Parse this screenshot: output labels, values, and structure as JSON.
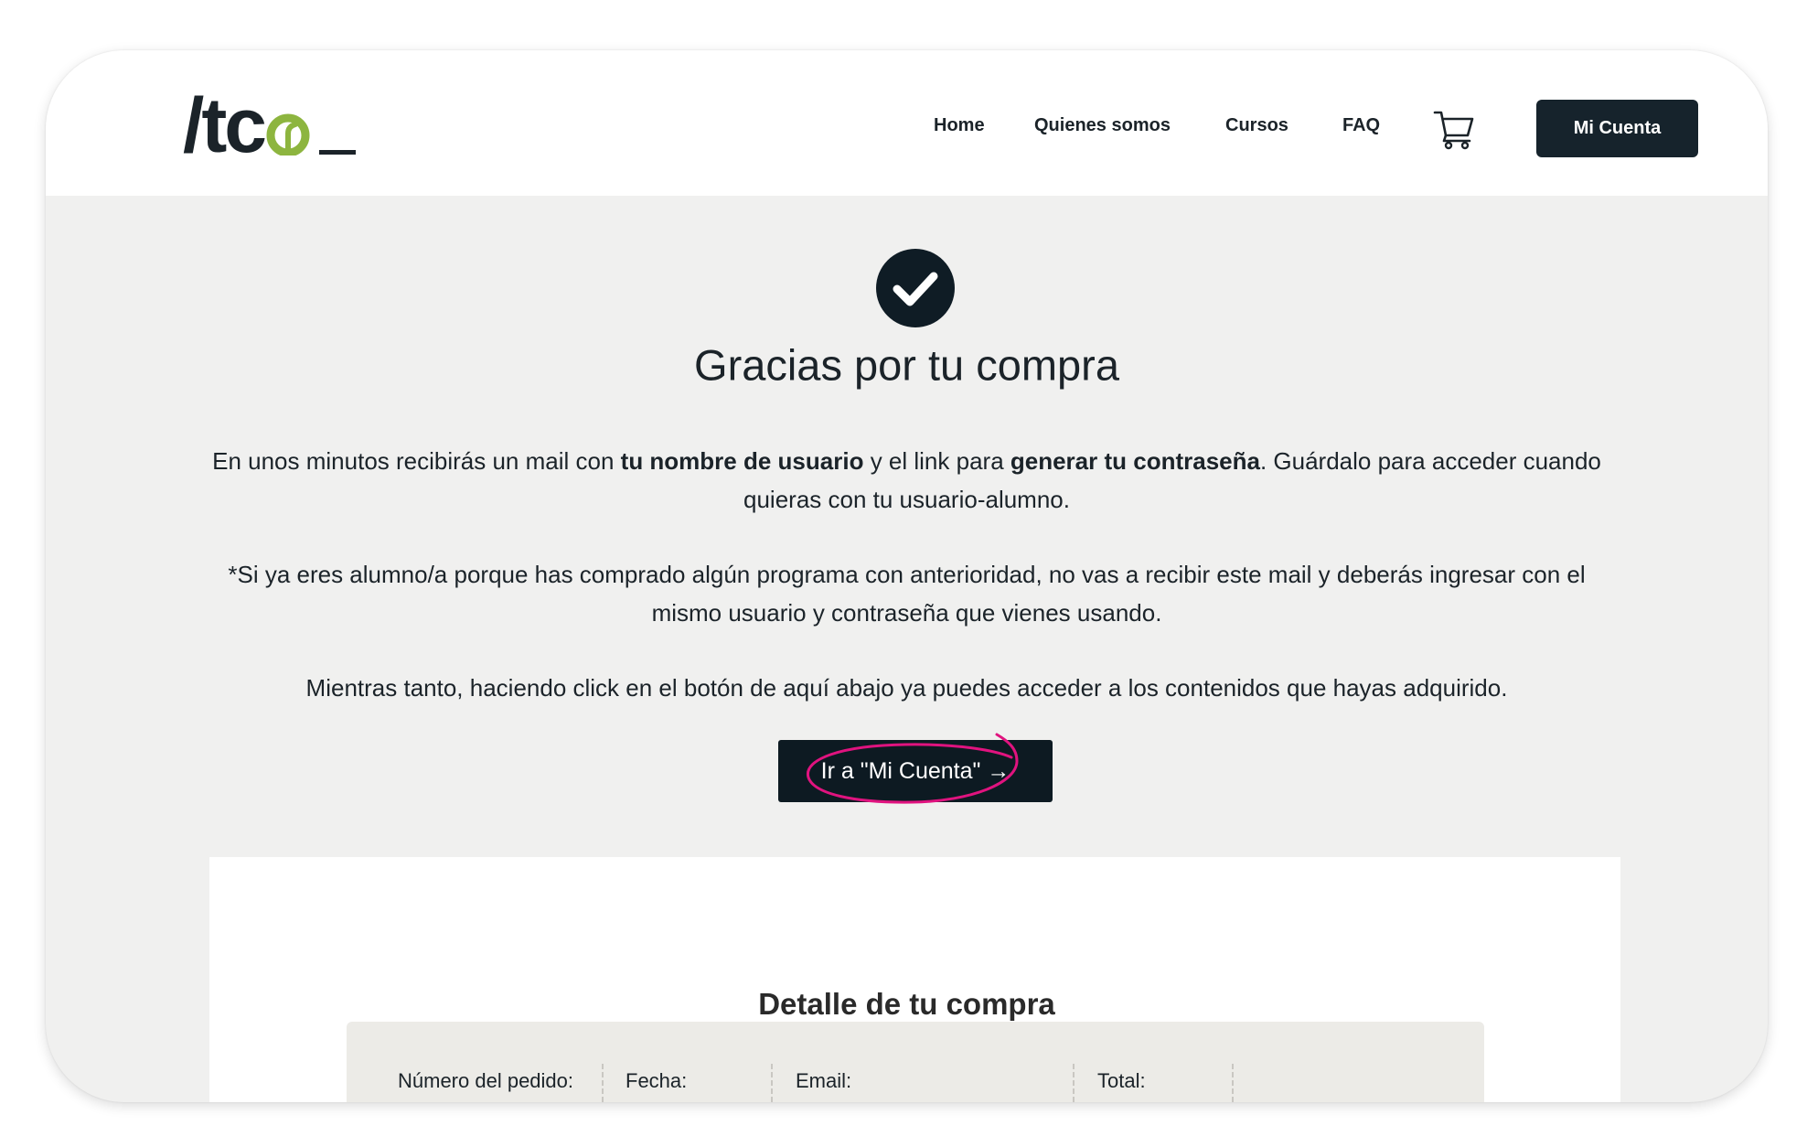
{
  "logo": {
    "text_prefix": "/tc",
    "alt": "/tco_",
    "accent_color": "#8db53f",
    "dark_color": "#1b2329"
  },
  "nav": {
    "items": [
      {
        "label": "Home"
      },
      {
        "label": "Quienes somos"
      },
      {
        "label": "Cursos"
      },
      {
        "label": "FAQ"
      }
    ],
    "cart_icon": "shopping-cart-icon",
    "account_button": "Mi Cuenta"
  },
  "confirmation": {
    "icon": "check-circle-icon",
    "title": "Gracias por tu compra",
    "para1": {
      "part1": "En unos minutos recibirás un mail con ",
      "bold1": "tu nombre de usuario",
      "part2": " y el link para ",
      "bold2": "generar tu contraseña",
      "part3": ". Guárdalo para acceder cuando quieras con tu usuario-alumno."
    },
    "para2": "*Si ya eres alumno/a porque has comprado algún programa con anterioridad, no vas a recibir este mail y deberás ingresar con el mismo usuario y contraseña que vienes usando.",
    "para3": "Mientras tanto, haciendo click en el botón de aquí abajo ya puedes acceder a los contenidos que hayas adquirido.",
    "cta_label": "Ir a \"Mi Cuenta\" →",
    "highlight_color": "#e0137f"
  },
  "detail": {
    "title": "Detalle de tu compra",
    "columns": [
      "Número del pedido:",
      "Fecha:",
      "Email:",
      "Total:"
    ]
  },
  "colors": {
    "page_bg": "#f0f0ef",
    "dark_button": "#16232c",
    "table_bg": "#ecebe7"
  }
}
